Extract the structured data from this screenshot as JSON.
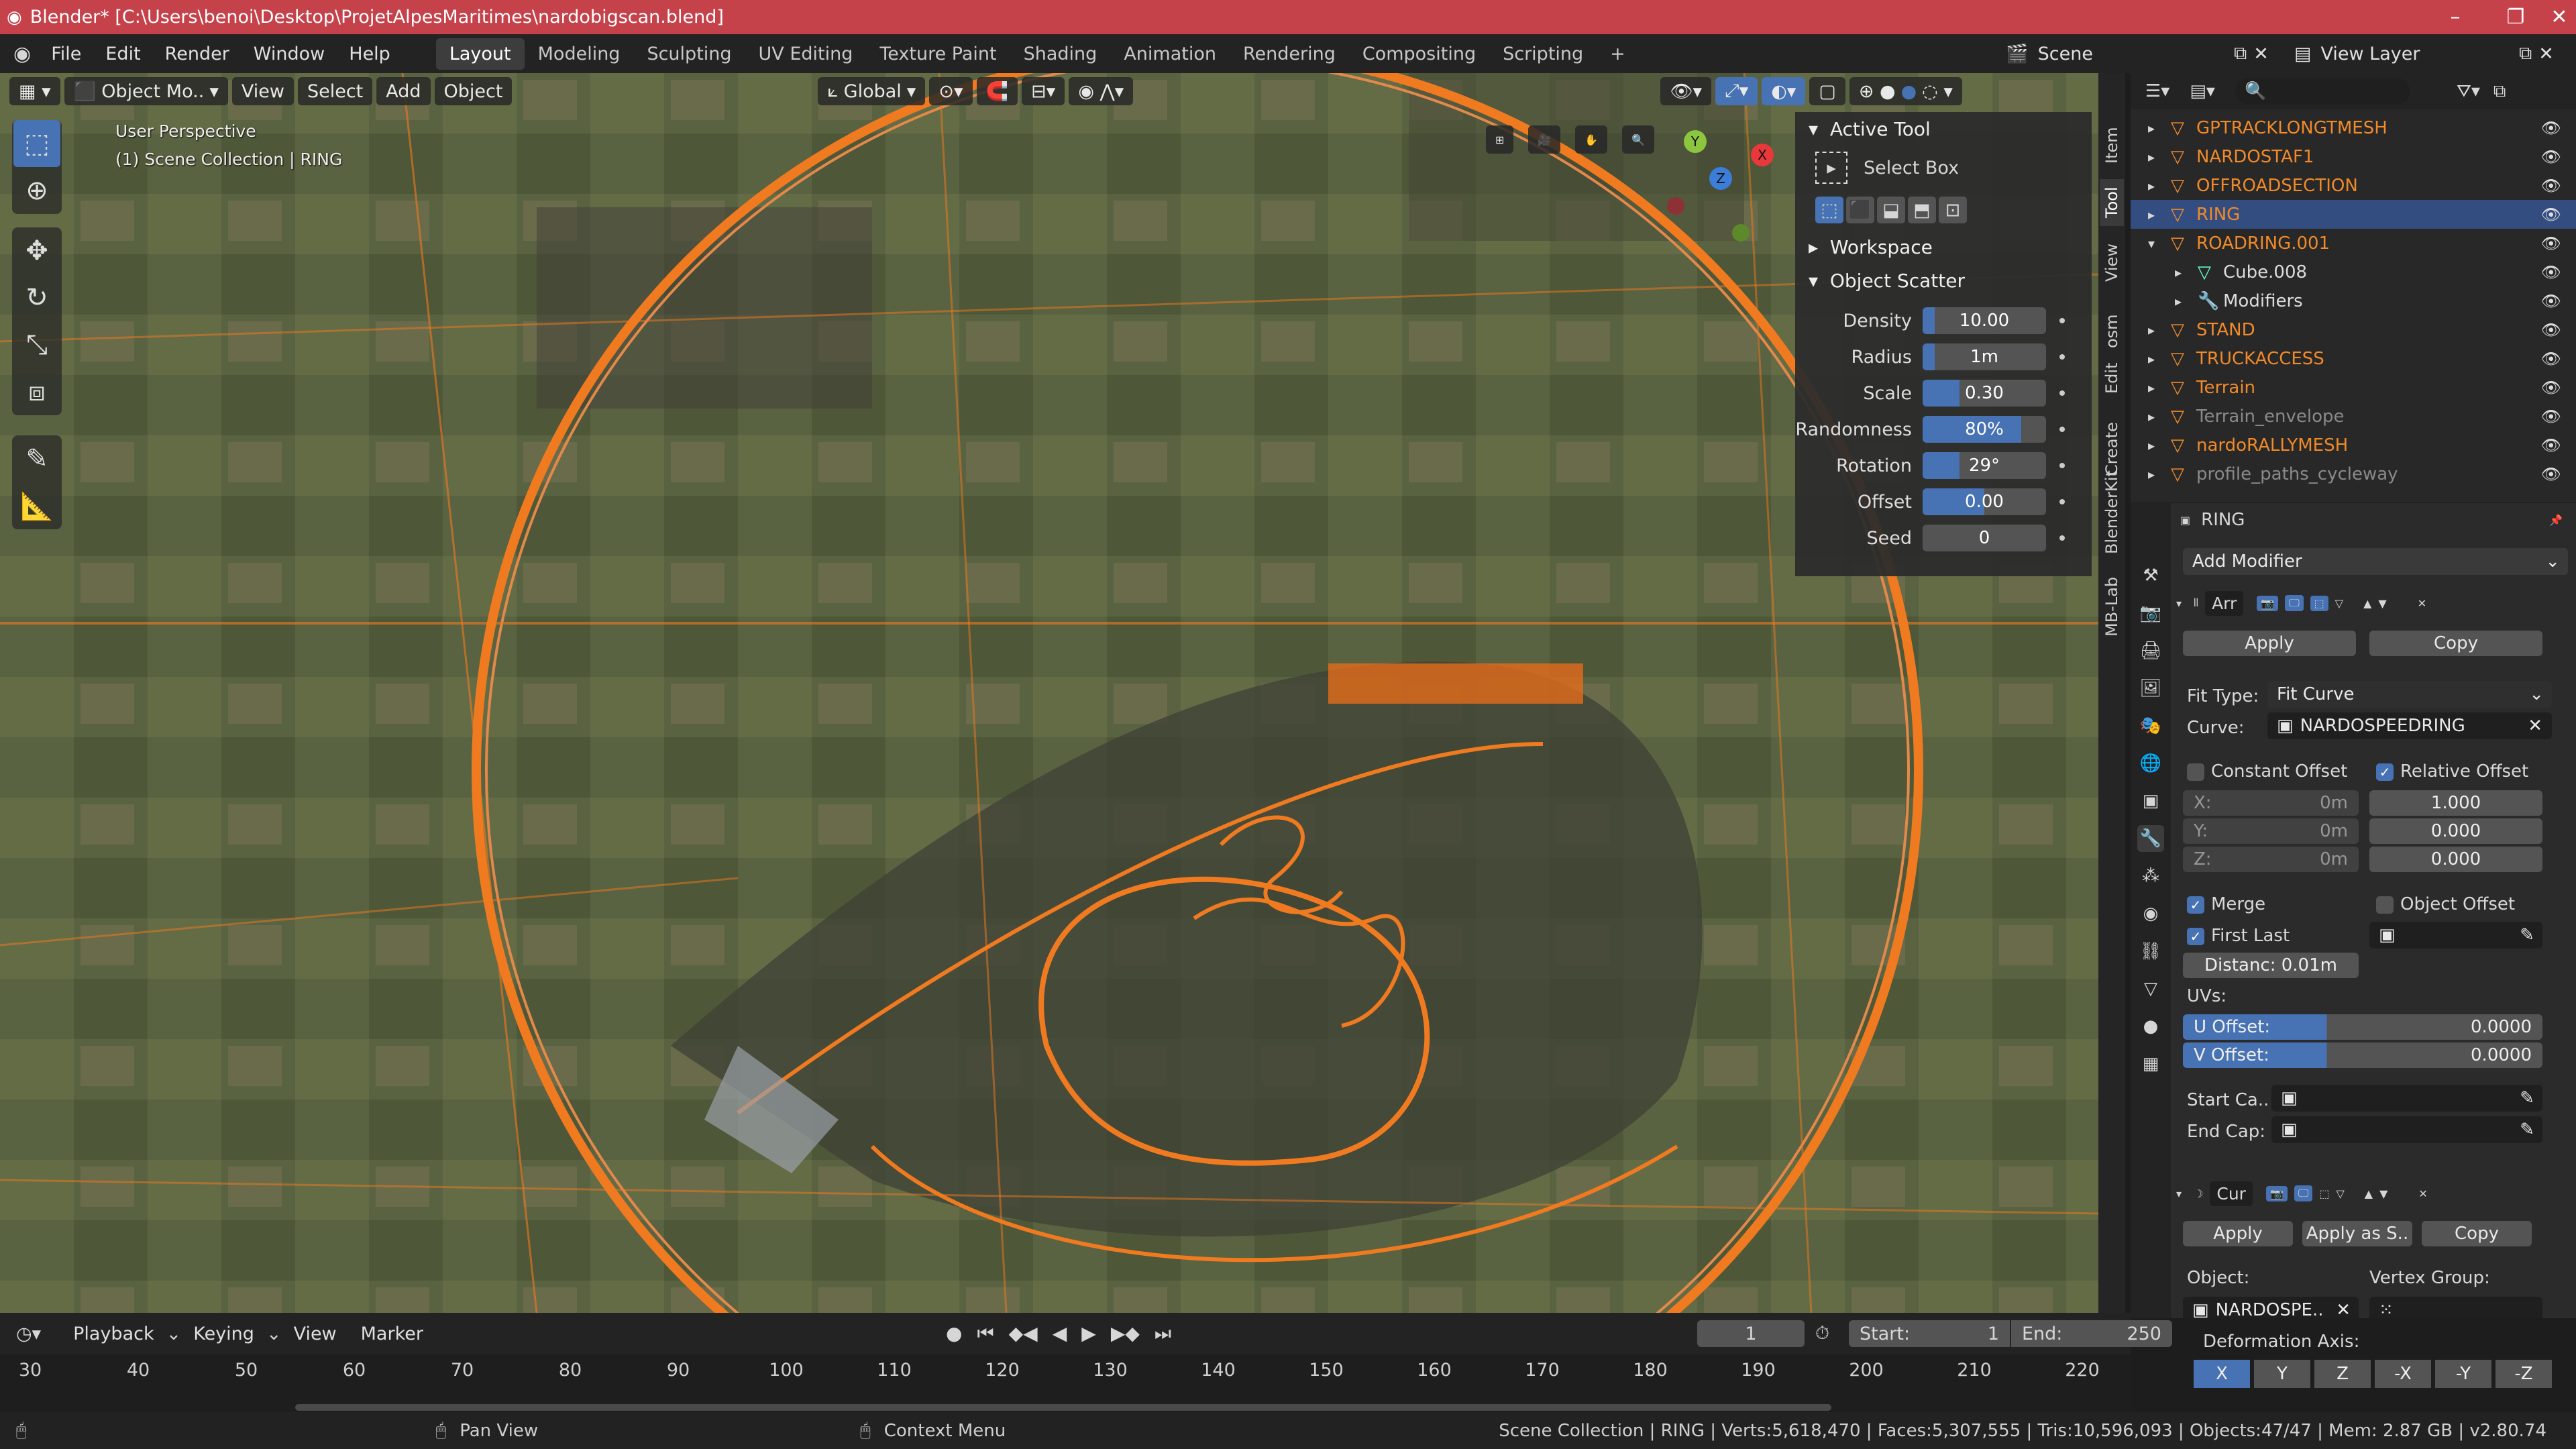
{
  "window": {
    "title": "Blender* [C:\\Users\\benoi\\Desktop\\ProjetAlpesMaritimes\\nardobigscan.blend]"
  },
  "menu": [
    "File",
    "Edit",
    "Render",
    "Window",
    "Help"
  ],
  "workspaces": [
    "Layout",
    "Modeling",
    "Sculpting",
    "UV Editing",
    "Texture Paint",
    "Shading",
    "Animation",
    "Rendering",
    "Compositing",
    "Scripting"
  ],
  "top_right": {
    "scene": "Scene",
    "view_layer": "View Layer"
  },
  "viewport": {
    "header": {
      "mode": "Object Mo..",
      "menus": [
        "View",
        "Select",
        "Add",
        "Object"
      ],
      "transform": "Global"
    },
    "overlay_line1": "User Perspective",
    "overlay_line2": "(1) Scene Collection | RING",
    "gizmo": {
      "x": "X",
      "y": "Y",
      "z": "Z"
    }
  },
  "npanel": {
    "active_tool_title": "Active Tool",
    "active_tool": "Select Box",
    "workspace_title": "Workspace",
    "scatter_title": "Object Scatter",
    "fields": [
      {
        "label": "Density",
        "value": "10.00",
        "fill": 0.1
      },
      {
        "label": "Radius",
        "value": "1m",
        "fill": 0.1
      },
      {
        "label": "Scale",
        "value": "0.30",
        "fill": 0.3
      },
      {
        "label": "Randomness",
        "value": "80%",
        "fill": 0.8
      },
      {
        "label": "Rotation",
        "value": "29°",
        "fill": 0.3
      },
      {
        "label": "Offset",
        "value": "0.00",
        "fill": 0.5
      },
      {
        "label": "Seed",
        "value": "0",
        "fill": 0.0
      }
    ],
    "tabs": [
      "Item",
      "Tool",
      "View",
      "osm",
      "Edit",
      "Create",
      "BlenderKit",
      "MB-Lab"
    ]
  },
  "outliner": {
    "items": [
      {
        "name": "GPTRACKLONGTMESH",
        "dim": false
      },
      {
        "name": "NARDOSTAF1",
        "dim": false
      },
      {
        "name": "OFFROADSECTION",
        "dim": false
      },
      {
        "name": "RING",
        "dim": false
      },
      {
        "name": "ROADRING.001",
        "dim": false
      },
      {
        "name": "Cube.008",
        "dim": false
      },
      {
        "name": "Modifiers",
        "dim": false
      },
      {
        "name": "STAND",
        "dim": false
      },
      {
        "name": "TRUCKACCESS",
        "dim": false
      },
      {
        "name": "Terrain",
        "dim": false
      },
      {
        "name": "Terrain_envelope",
        "dim": true
      },
      {
        "name": "nardoRALLYMESH",
        "dim": false
      },
      {
        "name": "profile_paths_cycleway",
        "dim": true
      }
    ]
  },
  "properties": {
    "object": "RING",
    "add_modifier": "Add Modifier",
    "array": {
      "name": "Arr",
      "apply": "Apply",
      "copy": "Copy",
      "fit_type_label": "Fit Type:",
      "fit_type": "Fit Curve",
      "curve_label": "Curve:",
      "curve": "NARDOSPEEDRING",
      "constant_offset": "Constant Offset",
      "relative_offset": "Relative Offset",
      "const_x": "X:",
      "const_y": "Y:",
      "const_z": "Z:",
      "const_vals": [
        "0m",
        "0m",
        "0m"
      ],
      "rel_vals": [
        "1.000",
        "0.000",
        "0.000"
      ],
      "merge": "Merge",
      "object_offset": "Object Offset",
      "first_last": "First Last",
      "distance": "Distanc: 0.01m",
      "uvs": "UVs:",
      "u_offset_label": "U Offset:",
      "u_offset": "0.0000",
      "v_offset_label": "V Offset:",
      "v_offset": "0.0000",
      "start_cap": "Start Ca..",
      "end_cap": "End Cap:"
    },
    "curve": {
      "name": "Cur",
      "apply": "Apply",
      "apply_as": "Apply as S..",
      "copy": "Copy",
      "object_label": "Object:",
      "object": "NARDOSPE..",
      "vertex_group_label": "Vertex Group:",
      "deformation_label": "Deformation Axis:",
      "axes": [
        "X",
        "Y",
        "Z",
        "-X",
        "-Y",
        "-Z"
      ],
      "active_axis": 0
    }
  },
  "timeline": {
    "menus": [
      "Playback",
      "Keying",
      "View",
      "Marker"
    ],
    "current_frame": "1",
    "start_label": "Start:",
    "start": "1",
    "end_label": "End:",
    "end": "250",
    "ticks": [
      "30",
      "40",
      "50",
      "60",
      "70",
      "80",
      "90",
      "100",
      "110",
      "120",
      "130",
      "140",
      "150",
      "160",
      "170",
      "180",
      "190",
      "200",
      "210",
      "220"
    ]
  },
  "statusbar": {
    "pan": "Pan View",
    "context": "Context Menu",
    "info": "Scene Collection | RING | Verts:5,618,470 | Faces:5,307,555 | Tris:10,596,093 | Objects:47/47 | Mem: 2.87 GB | v2.80.74"
  },
  "colors": {
    "accent": "#4772b3",
    "title_bar": "#c5424b",
    "object_orange": "#f08a2a"
  }
}
